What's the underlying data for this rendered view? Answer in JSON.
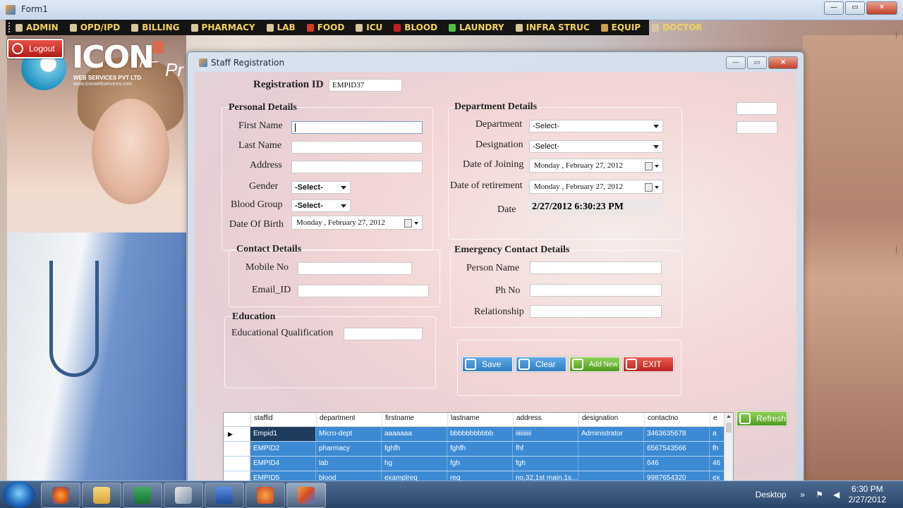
{
  "window": {
    "title": "Form1",
    "controls": {
      "minimize": "—",
      "maximize": "▭",
      "close": "✕"
    }
  },
  "menu": {
    "items": [
      {
        "label": "ADMIN",
        "icon": "admin-icon"
      },
      {
        "label": "OPD/IPD",
        "icon": "document-icon"
      },
      {
        "label": "BILLING",
        "icon": "billing-icon"
      },
      {
        "label": "PHARMACY",
        "icon": "pharmacy-icon"
      },
      {
        "label": "LAB",
        "icon": "lab-icon"
      },
      {
        "label": "FOOD",
        "icon": "food-icon"
      },
      {
        "label": "ICU",
        "icon": "icu-icon"
      },
      {
        "label": "BLOOD",
        "icon": "blood-icon"
      },
      {
        "label": "LAUNDRY",
        "icon": "laundry-icon"
      },
      {
        "label": "INFRA STRUC",
        "icon": "infrastructure-icon"
      },
      {
        "label": "EQUIP",
        "icon": "equipment-icon"
      },
      {
        "label": "DOCTOR",
        "icon": "doctor-icon"
      }
    ]
  },
  "logout": {
    "label": "Logout"
  },
  "logo": {
    "brand": "ICON",
    "sub": "WEB SERVICES PVT LTD",
    "url": "www.iconwebservices.com",
    "pro": "Pr"
  },
  "dialog": {
    "title": "Staff Registration",
    "registration": {
      "label": "Registration ID",
      "value": "EMPID37"
    },
    "personal": {
      "header": "Personal Details",
      "first_name": {
        "label": "First Name",
        "value": ""
      },
      "last_name": {
        "label": "Last Name",
        "value": ""
      },
      "address": {
        "label": "Address",
        "value": ""
      },
      "gender": {
        "label": "Gender",
        "value": "-Select-"
      },
      "blood_group": {
        "label": "Blood Group",
        "value": "-Select-"
      },
      "dob": {
        "label": "Date Of Birth",
        "value": "Monday  ,  February  27, 2012"
      }
    },
    "department": {
      "header": "Department Details",
      "department": {
        "label": "Department",
        "value": "-Select-"
      },
      "designation": {
        "label": "Designation",
        "value": "-Select-"
      },
      "joining": {
        "label": "Date of Joining",
        "value": "Monday  ,  February  27, 2012"
      },
      "retirement": {
        "label": "Date of retirement",
        "value": "Monday  ,  February  27, 2012"
      },
      "date": {
        "label": "Date",
        "value": "2/27/2012 6:30:23 PM"
      }
    },
    "contact": {
      "header": "Contact Details",
      "mobile": {
        "label": "Mobile No",
        "value": ""
      },
      "email": {
        "label": "Email_ID",
        "value": ""
      }
    },
    "education": {
      "header": "Education",
      "qualification": {
        "label": "Educational Qualification",
        "value": ""
      }
    },
    "emergency": {
      "header": "Emergency Contact Details",
      "person": {
        "label": "Person Name",
        "value": ""
      },
      "phone": {
        "label": "Ph No",
        "value": ""
      },
      "relationship": {
        "label": "Relationship",
        "value": ""
      }
    },
    "buttons": {
      "save": "Save",
      "clear": "Clear",
      "add_new": "Add New",
      "exit": "EXIT",
      "refresh": "Refresh"
    },
    "grid": {
      "columns": [
        "staffid",
        "department",
        "firstname",
        "lastname",
        "address",
        "designation",
        "contactno",
        "e"
      ],
      "rows": [
        [
          "Empid1",
          "Micro-dept",
          "aaaaaaa",
          "bbbbbbbbbbb",
          "iiiiiiiiii",
          "Administrator",
          "3463635678",
          "a"
        ],
        [
          "EMPID2",
          "pharmacy",
          "fghfh",
          "fghfh",
          "fhf",
          "",
          "6567543566",
          "fh"
        ],
        [
          "EMPID4",
          "lab",
          "hg",
          "fgh",
          "fgh",
          "",
          "646",
          "46"
        ],
        [
          "EMPID5",
          "blood",
          "examplreg",
          "reg",
          "no,32,1st main,1s...",
          "",
          "9987654320",
          "ex"
        ]
      ],
      "current_row_marker": "▶"
    }
  },
  "taskbar": {
    "apps": [
      "firefox-icon",
      "file-explorer-icon",
      "excel-icon",
      "tools-icon",
      "word-icon",
      "media-icon",
      "windows-forms-icon"
    ],
    "desktop_label": "Desktop",
    "time": "6:30 PM",
    "date": "2/27/2012"
  }
}
